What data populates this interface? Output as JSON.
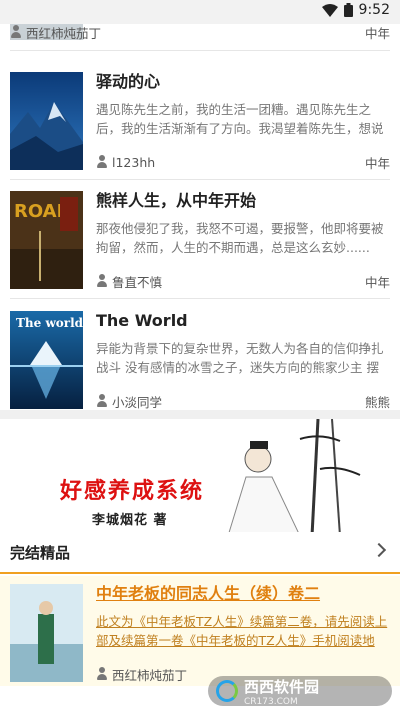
{
  "status_bar": {
    "time": "9:52",
    "icons": [
      "wifi-icon",
      "battery-icon"
    ]
  },
  "top_partial_item": {
    "author": "西红柿炖茄丁",
    "tag": "中年"
  },
  "books": [
    {
      "title": "驿动的心",
      "desc": "遇见陈先生之前，我的生活一团糟。遇见陈先生之后，我的生活渐渐有了方向。我渴望着陈先生，想说的千...",
      "author": "l123hh",
      "tag": "中年"
    },
    {
      "title": "熊样人生，从中年开始",
      "desc": "那夜他侵犯了我，我怒不可遏，要报警，他即将要被拘留，然而，人生的不期而遇，总是这么玄妙......",
      "author": "鲁直不慎",
      "tag": "中年",
      "cover_text": "ROAD"
    },
    {
      "title": "The World",
      "desc": "异能为背景下的复杂世界，无数人为各自的信仰挣扎战斗 没有感情的冰雪之子，迷失方向的熊家少主 摆在他...",
      "author": "小淡同学",
      "tag": "熊熊",
      "cover_text": "The world"
    }
  ],
  "banner": {
    "text": "好感养成系统",
    "byline": "李城烟花 著"
  },
  "section": {
    "title": "完结精品"
  },
  "featured": {
    "title": "中年老板的同志人生（续）卷二",
    "desc": "此文为《中年老板TZ人生》续篇第二卷，请先阅读上部及续篇第一卷《中年老板的TZ人生》手机阅读地址:...",
    "author": "西红柿炖茄丁"
  },
  "watermark": {
    "brand": "西西软件园",
    "url": "CR173.COM"
  },
  "colors": {
    "accent": "#f0a020",
    "featured_bg": "#fffbe9",
    "banner_red": "#d11111"
  }
}
